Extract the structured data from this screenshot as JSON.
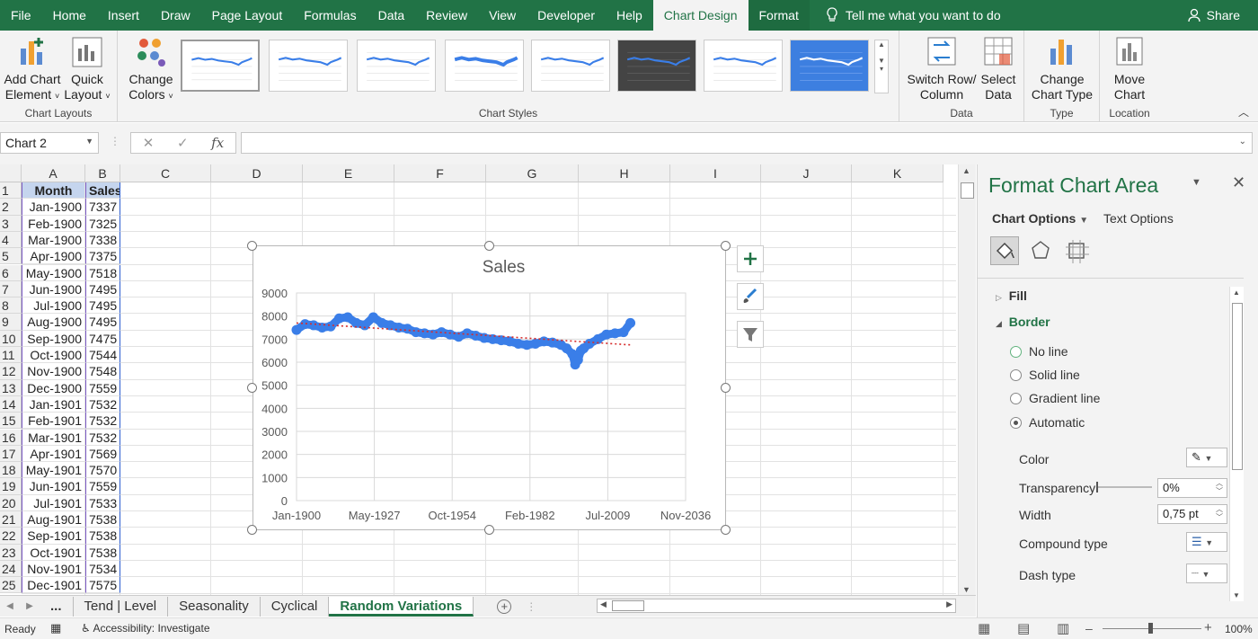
{
  "menu": {
    "tabs": [
      "File",
      "Home",
      "Insert",
      "Draw",
      "Page Layout",
      "Formulas",
      "Data",
      "Review",
      "View",
      "Developer",
      "Help",
      "Chart Design",
      "Format"
    ],
    "active_tab": "Chart Design",
    "tell_me": "Tell me what you want to do",
    "share": "Share"
  },
  "ribbon": {
    "add_chart_element": [
      "Add Chart",
      "Element"
    ],
    "quick_layout": [
      "Quick",
      "Layout"
    ],
    "chart_layouts_label": "Chart Layouts",
    "change_colors": [
      "Change",
      "Colors"
    ],
    "chart_styles_label": "Chart Styles",
    "switch_row_col": [
      "Switch Row/",
      "Column"
    ],
    "select_data": [
      "Select",
      "Data"
    ],
    "data_label": "Data",
    "change_chart_type": [
      "Change",
      "Chart Type"
    ],
    "type_label": "Type",
    "move_chart": [
      "Move",
      "Chart"
    ],
    "location_label": "Location"
  },
  "formula_bar": {
    "name_box": "Chart 2",
    "fx": "fx",
    "value": ""
  },
  "grid": {
    "columns": [
      "A",
      "B",
      "C",
      "D",
      "E",
      "F",
      "G",
      "H",
      "I",
      "J",
      "K"
    ],
    "header_row": [
      "Month",
      "Sales"
    ],
    "rows": [
      [
        "Jan-1900",
        "7337"
      ],
      [
        "Feb-1900",
        "7325"
      ],
      [
        "Mar-1900",
        "7338"
      ],
      [
        "Apr-1900",
        "7375"
      ],
      [
        "May-1900",
        "7518"
      ],
      [
        "Jun-1900",
        "7495"
      ],
      [
        "Jul-1900",
        "7495"
      ],
      [
        "Aug-1900",
        "7495"
      ],
      [
        "Sep-1900",
        "7475"
      ],
      [
        "Oct-1900",
        "7544"
      ],
      [
        "Nov-1900",
        "7548"
      ],
      [
        "Dec-1900",
        "7559"
      ],
      [
        "Jan-1901",
        "7532"
      ],
      [
        "Feb-1901",
        "7532"
      ],
      [
        "Mar-1901",
        "7532"
      ],
      [
        "Apr-1901",
        "7569"
      ],
      [
        "May-1901",
        "7570"
      ],
      [
        "Jun-1901",
        "7559"
      ],
      [
        "Jul-1901",
        "7533"
      ],
      [
        "Aug-1901",
        "7538"
      ],
      [
        "Sep-1901",
        "7538"
      ],
      [
        "Oct-1901",
        "7538"
      ],
      [
        "Nov-1901",
        "7534"
      ],
      [
        "Dec-1901",
        "7575"
      ]
    ]
  },
  "sheet_tabs": [
    "...",
    "Tend | Level",
    "Seasonality",
    "Cyclical",
    "Random Variations"
  ],
  "active_sheet": "Random Variations",
  "status": {
    "ready": "Ready",
    "accessibility": "Accessibility: Investigate",
    "zoom": "100%"
  },
  "pane": {
    "title": "Format Chart Area",
    "chart_options": "Chart Options",
    "text_options": "Text Options",
    "fill": "Fill",
    "border": "Border",
    "line_options": [
      "No line",
      "Solid line",
      "Gradient line",
      "Automatic"
    ],
    "selected_line": "Automatic",
    "color_label": "Color",
    "transparency_label": "Transparency",
    "transparency_value": "0%",
    "transparency_level": 0,
    "width_label": "Width",
    "width_value": "0,75 pt",
    "compound_label": "Compound type",
    "dash_label": "Dash type"
  },
  "chart_data": {
    "type": "line",
    "title": "Sales",
    "x_tick_labels": [
      "Jan-1900",
      "May-1927",
      "Oct-1954",
      "Feb-1982",
      "Jul-2009",
      "Nov-2036"
    ],
    "xlim": [
      "1900-01",
      "2036-11"
    ],
    "ylim": [
      0,
      9000
    ],
    "y_ticks": [
      0,
      1000,
      2000,
      3000,
      4000,
      5000,
      6000,
      7000,
      8000,
      9000
    ],
    "grid": true,
    "legend": "none",
    "series": [
      {
        "style": "markers",
        "color": "#3a7ee8",
        "x": [
          "1900-01",
          "1903-01",
          "1906-01",
          "1909-01",
          "1912-01",
          "1915-01",
          "1918-01",
          "1921-01",
          "1924-01",
          "1927-01",
          "1930-01",
          "1933-01",
          "1936-01",
          "1939-01",
          "1942-01",
          "1945-01",
          "1948-01",
          "1951-01",
          "1954-01",
          "1957-01",
          "1960-01",
          "1963-01",
          "1966-01",
          "1969-01",
          "1972-01",
          "1975-01",
          "1978-01",
          "1981-01",
          "1984-01",
          "1987-01",
          "1990-01",
          "1993-01",
          "1995-01",
          "1997-01",
          "1998-01",
          "1999-01",
          "2000-01",
          "2001-01",
          "2003-01",
          "2006-01",
          "2009-01",
          "2012-01",
          "2015-01",
          "2017-06"
        ],
        "y": [
          7400,
          7650,
          7600,
          7500,
          7550,
          7900,
          7950,
          7700,
          7600,
          7950,
          7700,
          7600,
          7500,
          7450,
          7300,
          7250,
          7200,
          7300,
          7200,
          7100,
          7250,
          7150,
          7050,
          7000,
          6950,
          6900,
          6800,
          6750,
          6800,
          6900,
          6850,
          6750,
          6600,
          6350,
          5900,
          6100,
          6500,
          6600,
          6800,
          7000,
          7200,
          7250,
          7300,
          7700
        ]
      },
      {
        "style": "trendline",
        "color": "#d62c2c",
        "x": [
          "1900-01",
          "2017-06"
        ],
        "y": [
          7700,
          6750
        ]
      }
    ]
  }
}
